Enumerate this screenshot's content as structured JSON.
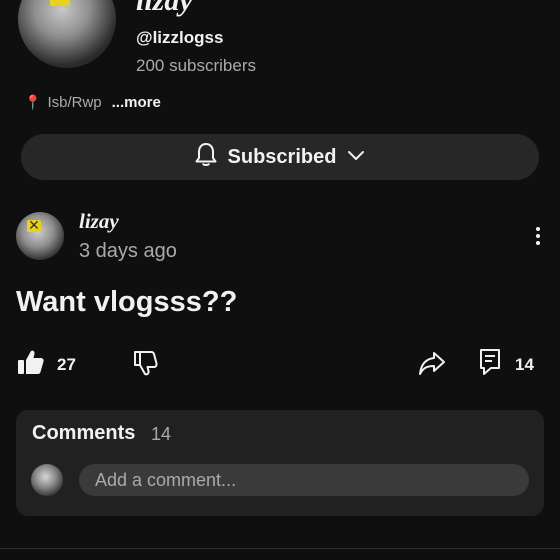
{
  "channel": {
    "name": "lizay",
    "handle": "@lizzlogss",
    "subscribers": "200 subscribers",
    "location": "Isb/Rwp",
    "more_label": "...more",
    "subscribe_button": {
      "label": "Subscribed",
      "icon": "bell-icon",
      "dropdown_icon": "chevron-down-icon"
    }
  },
  "post": {
    "author": "lizay",
    "time": "3 days ago",
    "text": "Want vlogsss??",
    "likes": "27",
    "comment_count": "14"
  },
  "comments": {
    "title": "Comments",
    "count": "14",
    "input_placeholder": "Add a comment..."
  },
  "colors": {
    "background": "#0f0f0f",
    "surface": "#272727",
    "card": "#212121",
    "text_primary": "#f1f1f1",
    "text_secondary": "#aaaaaa",
    "pin": "#e0463b",
    "avatar_mark": "#e8d21c"
  }
}
